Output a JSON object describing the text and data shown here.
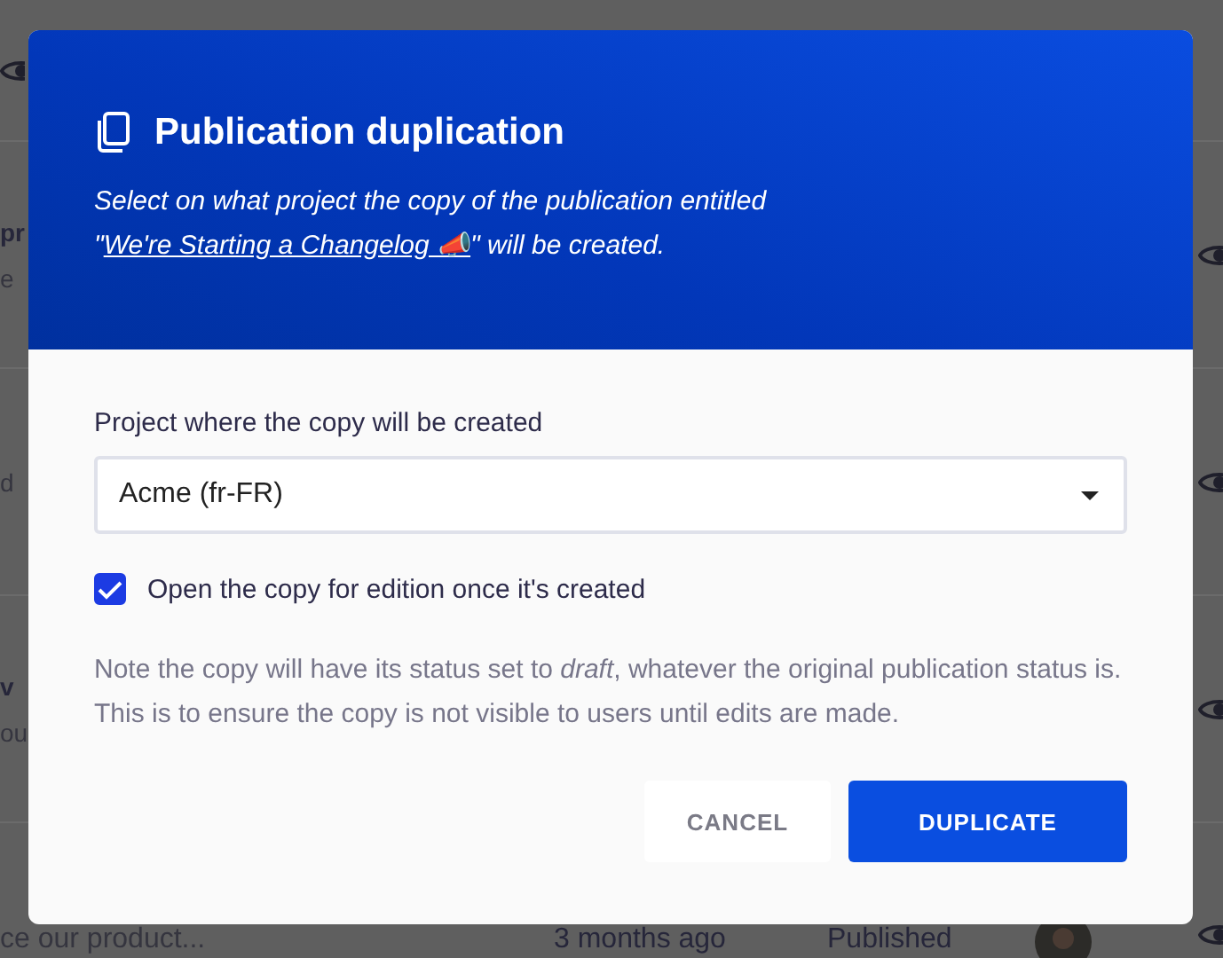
{
  "background_list": {
    "rows": [
      {
        "title": "pr",
        "excerpt": "e"
      },
      {
        "excerpt": "d"
      },
      {
        "title": "v",
        "excerpt": "ou"
      },
      {
        "excerpt": "ce our product...",
        "date": "3 months ago",
        "status": "Published"
      }
    ]
  },
  "dialog": {
    "title": "Publication duplication",
    "description": {
      "before": "Select on what project the copy of the publication entitled \"",
      "link": "We're Starting a Changelog 📣",
      "after": "\" will be created."
    },
    "project_field": {
      "label": "Project where the copy will be created",
      "value": "Acme (fr-FR)"
    },
    "open_copy": {
      "label": "Open the copy for edition once it's created",
      "checked": true
    },
    "note": "Note the copy will have its status set to *draft*, whatever the original publication status is. This is to ensure the copy is not visible to users until edits are made.",
    "buttons": [
      {
        "label": "CANCEL",
        "kind": "secondary"
      },
      {
        "label": "DUPLICATE",
        "kind": "primary"
      }
    ]
  }
}
